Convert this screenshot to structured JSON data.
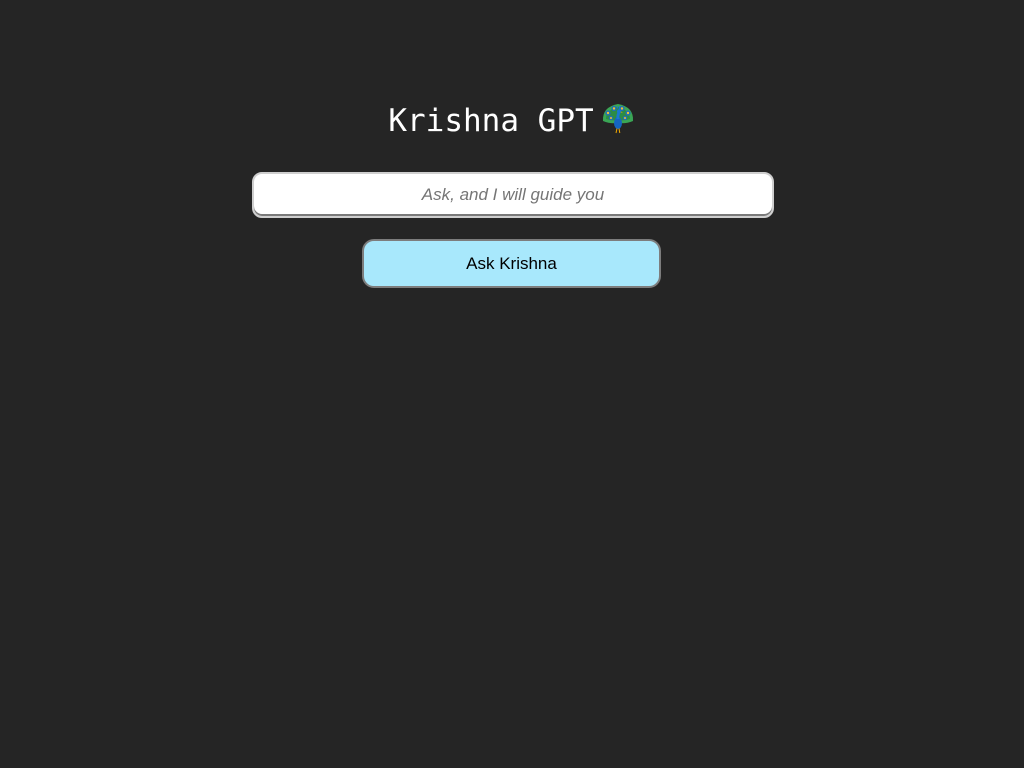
{
  "header": {
    "title": "Krishna GPT",
    "title_icon": "peacock-icon"
  },
  "search": {
    "value": "",
    "placeholder": "Ask, and I will guide you"
  },
  "actions": {
    "ask_label": "Ask Krishna"
  },
  "colors": {
    "background": "#252525",
    "title_text": "#ffffff",
    "button_background": "#a8e8fc",
    "input_background": "#ffffff"
  }
}
